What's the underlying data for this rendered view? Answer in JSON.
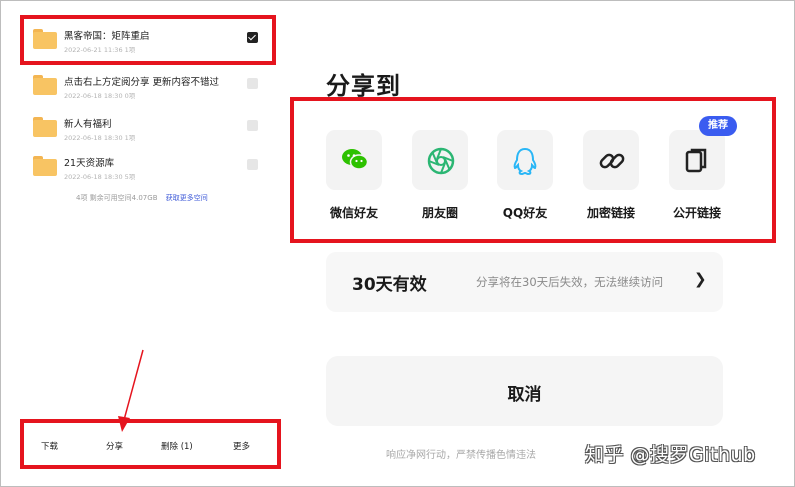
{
  "files": [
    {
      "name": "黑客帝国：矩阵重启",
      "meta": "2022-06-21 11:36  1项",
      "checked": true
    },
    {
      "name": "点击右上方定阅分享 更新内容不错过",
      "meta": "2022-06-18 18:30  0项",
      "checked": false
    },
    {
      "name": "新人有福利",
      "meta": "2022-06-18 18:30  1项",
      "checked": false
    },
    {
      "name": "21天资源库",
      "meta": "2022-06-18 18:30  5项",
      "checked": false
    }
  ],
  "storage": {
    "text": "4项 剩余可用空间4.07GB",
    "link": "获取更多空间"
  },
  "bottom_bar": {
    "download": "下载",
    "share": "分享",
    "delete": "删除 (1)",
    "more": "更多"
  },
  "share_sheet": {
    "title": "分享到",
    "targets": [
      {
        "label": "微信好友",
        "icon": "wechat-icon"
      },
      {
        "label": "朋友圈",
        "icon": "moments-icon"
      },
      {
        "label": "QQ好友",
        "icon": "qq-icon"
      },
      {
        "label": "加密链接",
        "icon": "link-icon"
      },
      {
        "label": "公开链接",
        "icon": "copy-icon"
      }
    ],
    "recommend_badge": "推荐",
    "validity": {
      "value": "30天有效",
      "description": "分享将在30天后失效，无法继续访问",
      "chevron": "❯"
    },
    "cancel": "取消",
    "notice": "响应净网行动，严禁传播色情违法",
    "watermark": "知乎 @搜罗Github"
  },
  "colors": {
    "highlight": "#e5141e",
    "badge": "#3a5cf0",
    "wechat": "#2dc100",
    "moments": "#2bb673",
    "qq": "#29b6f6",
    "folder": "#f8c463"
  }
}
